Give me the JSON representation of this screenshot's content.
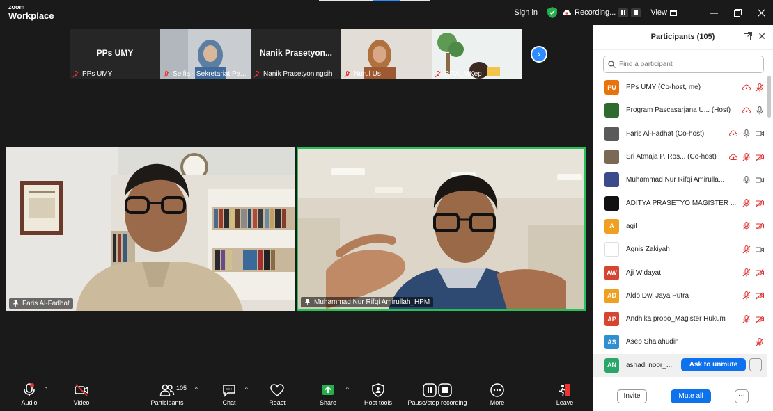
{
  "app": {
    "brand_top": "zoom",
    "brand_bottom": "Workplace"
  },
  "topbar": {
    "sign_in": "Sign in",
    "recording": "Recording...",
    "view": "View"
  },
  "strip": [
    {
      "big_name": "PPs UMY",
      "label": "PPs UMY"
    },
    {
      "big_name": "",
      "label": "Selfia - Sekretariat Pa..."
    },
    {
      "big_name": "Nanik Prasetyon...",
      "label": "Nanik Prasetyoningsih"
    },
    {
      "big_name": "",
      "label": "Nurul Us"
    },
    {
      "big_name": "",
      "label": "RITA_MKep"
    }
  ],
  "tiles": {
    "left": {
      "label": "Faris Al-Fadhat"
    },
    "right": {
      "label": "Muhammad Nur Rifqi Amirullah_HPM"
    }
  },
  "toolbar": {
    "audio": "Audio",
    "video": "Video",
    "participants": "Participants",
    "participants_count": "105",
    "chat": "Chat",
    "react": "React",
    "share": "Share",
    "host_tools": "Host tools",
    "record": "Pause/stop recording",
    "more": "More",
    "leave": "Leave"
  },
  "panel": {
    "title": "Participants (105)",
    "search_placeholder": "Find a participant",
    "participants": [
      {
        "initials": "PU",
        "color": "#e8730c",
        "name": "PPs UMY (Co-host, me)",
        "icons": [
          "rec",
          "mic-off"
        ]
      },
      {
        "initials": "",
        "color": "#2e6b2e",
        "name": "Program Pascasarjana U... (Host)",
        "icons": [
          "rec",
          "mic"
        ]
      },
      {
        "initials": "",
        "color": "#5a5a5a",
        "name": "Faris Al-Fadhat (Co-host)",
        "icons": [
          "rec",
          "mic",
          "cam"
        ]
      },
      {
        "initials": "",
        "color": "#7a6a55",
        "name": "Sri Atmaja P. Ros... (Co-host)",
        "icons": [
          "rec",
          "mic-off",
          "cam-off"
        ]
      },
      {
        "initials": "",
        "color": "#3a4a8a",
        "name": "Muhammad Nur Rifqi Amirulla...",
        "icons": [
          "mic",
          "cam"
        ]
      },
      {
        "initials": "",
        "color": "#111111",
        "name": "ADITYA PRASETYO MAGISTER ...",
        "icons": [
          "mic-off",
          "cam-off"
        ]
      },
      {
        "initials": "A",
        "color": "#f0a020",
        "name": "agil",
        "icons": [
          "mic-off",
          "cam-off"
        ]
      },
      {
        "initials": "",
        "color": "#ffffff",
        "name": "Agnis Zakiyah",
        "icons": [
          "mic-off",
          "cam"
        ]
      },
      {
        "initials": "AW",
        "color": "#d64531",
        "name": "Aji Widayat",
        "icons": [
          "mic-off",
          "cam-off"
        ]
      },
      {
        "initials": "AD",
        "color": "#f0a020",
        "name": "Aldo Dwi Jaya Putra",
        "icons": [
          "mic-off",
          "cam-off"
        ]
      },
      {
        "initials": "AP",
        "color": "#d64531",
        "name": "Andhika probo_Magister Hukum",
        "icons": [
          "mic-off",
          "cam-off"
        ]
      },
      {
        "initials": "AS",
        "color": "#2f8fd0",
        "name": "Asep Shalahudin",
        "icons": [
          "mic-off"
        ]
      },
      {
        "initials": "AN",
        "color": "#2aa66a",
        "name": "ashadi noor_...",
        "icons": []
      }
    ],
    "ask_to_unmute": "Ask to unmute",
    "invite": "Invite",
    "mute_all": "Mute all"
  }
}
